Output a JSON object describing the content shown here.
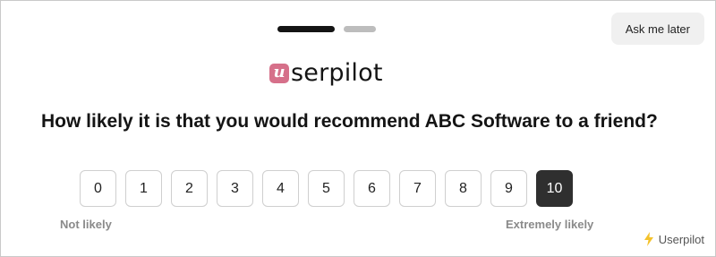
{
  "progress": {
    "steps": [
      {
        "state": "active"
      },
      {
        "state": "inactive"
      }
    ],
    "current_step": 1,
    "total_steps": 2
  },
  "header": {
    "ask_later_label": "Ask me later"
  },
  "logo": {
    "mark_letter": "u",
    "text": "serpilot",
    "mark_color": "#d6708a"
  },
  "survey": {
    "question": "How likely it is that you would recommend ABC Software to a friend?",
    "scale": [
      "0",
      "1",
      "2",
      "3",
      "4",
      "5",
      "6",
      "7",
      "8",
      "9",
      "10"
    ],
    "selected_value": "10",
    "low_label": "Not likely",
    "high_label": "Extremely likely"
  },
  "footer": {
    "powered_by": "Userpilot",
    "icon": "lightning-bolt-icon",
    "icon_color": "#f4c22b"
  },
  "colors": {
    "selected_bg": "#2f2f2f",
    "step_active": "#141414",
    "step_inactive": "#bdbdbd"
  }
}
